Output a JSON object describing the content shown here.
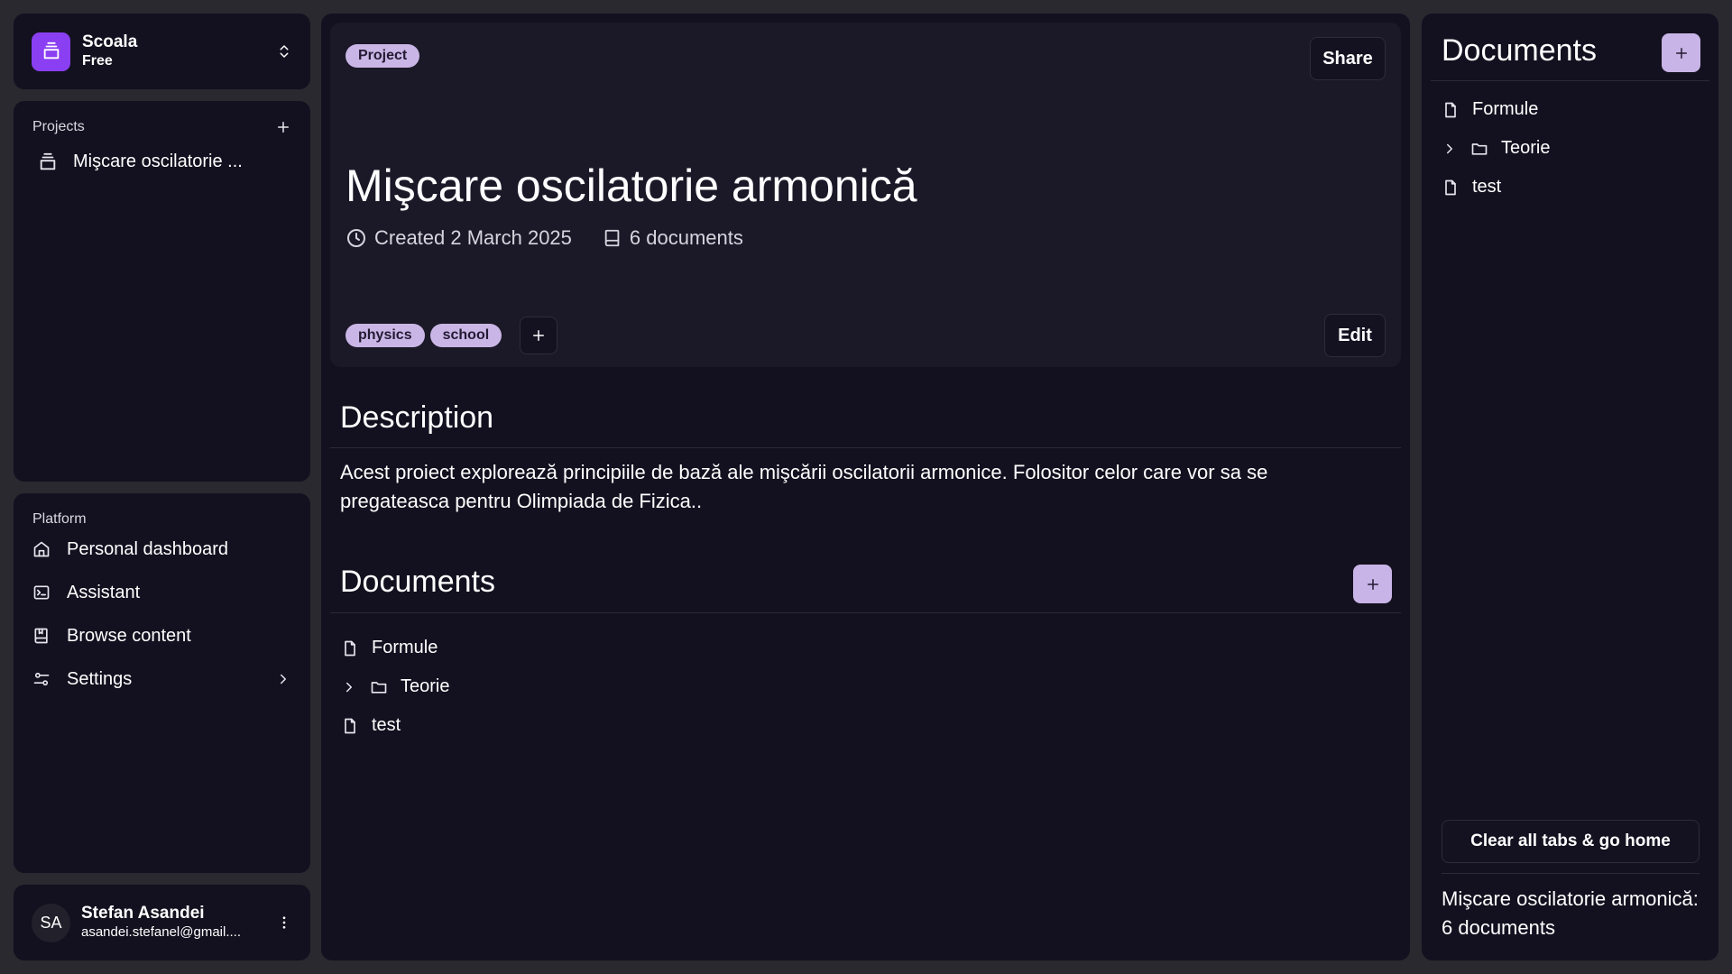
{
  "workspace": {
    "name": "Scoala",
    "plan": "Free"
  },
  "projects": {
    "label": "Projects",
    "items": [
      {
        "label": "Mişcare oscilatorie ..."
      }
    ]
  },
  "platform": {
    "label": "Platform",
    "items": [
      {
        "label": "Personal dashboard",
        "icon": "home-icon"
      },
      {
        "label": "Assistant",
        "icon": "terminal-icon"
      },
      {
        "label": "Browse content",
        "icon": "book-icon"
      },
      {
        "label": "Settings",
        "icon": "settings-icon"
      }
    ]
  },
  "user": {
    "initials": "SA",
    "name": "Stefan Asandei",
    "email": "asandei.stefanel@gmail...."
  },
  "hero": {
    "badge": "Project",
    "share_label": "Share",
    "title": "Mişcare oscilatorie armonică",
    "created": "Created 2 March 2025",
    "documents_count": "6 documents",
    "tags": [
      "physics",
      "school"
    ],
    "edit_label": "Edit"
  },
  "description": {
    "heading": "Description",
    "text": "Acest proiect explorează principiile de bază ale mişcării oscilatorii armonice. Folositor celor care vor sa se pregateasca pentru Olimpiada de Fizica.."
  },
  "documents": {
    "heading": "Documents",
    "items": [
      {
        "label": "Formule",
        "type": "file"
      },
      {
        "label": "Teorie",
        "type": "folder"
      },
      {
        "label": "test",
        "type": "file"
      }
    ]
  },
  "right_panel": {
    "title": "Documents",
    "items": [
      {
        "label": "Formule",
        "type": "file"
      },
      {
        "label": "Teorie",
        "type": "folder"
      },
      {
        "label": "test",
        "type": "file"
      }
    ],
    "clear_label": "Clear all tabs & go home",
    "summary": "Mişcare oscilatorie armonică: 6 documents"
  },
  "colors": {
    "accent": "#8b3ff2",
    "pill": "#cab6e6",
    "panel": "#13111f",
    "background": "#2a2930"
  }
}
